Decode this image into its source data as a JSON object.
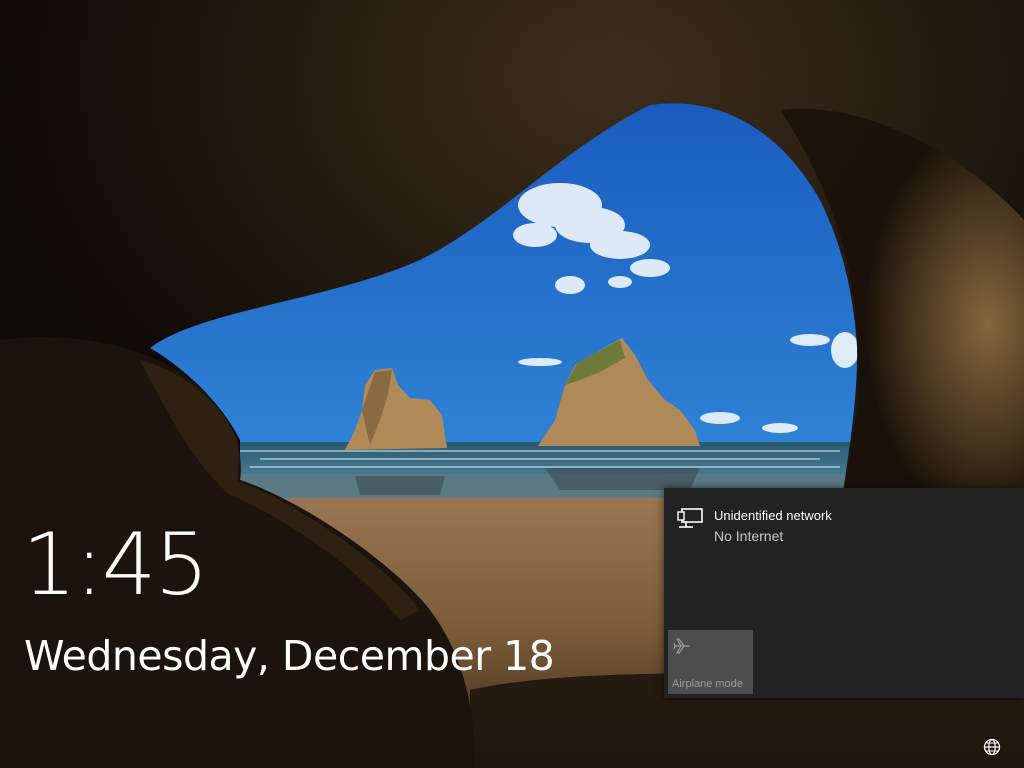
{
  "lockscreen": {
    "time": "1:45",
    "date": "Wednesday, December 18"
  },
  "network_flyout": {
    "network_name": "Unidentified network",
    "network_status": "No Internet",
    "network_icon": "wired-network-icon",
    "airplane_mode_label": "Airplane mode",
    "airplane_mode_icon": "airplane-icon"
  },
  "tray": {
    "network_icon": "globe-network-icon"
  },
  "colors": {
    "flyout_bg": "#222222",
    "tile_bg": "#4d4d4d",
    "text_primary": "#ffffff",
    "text_secondary": "#c8c8c8"
  }
}
